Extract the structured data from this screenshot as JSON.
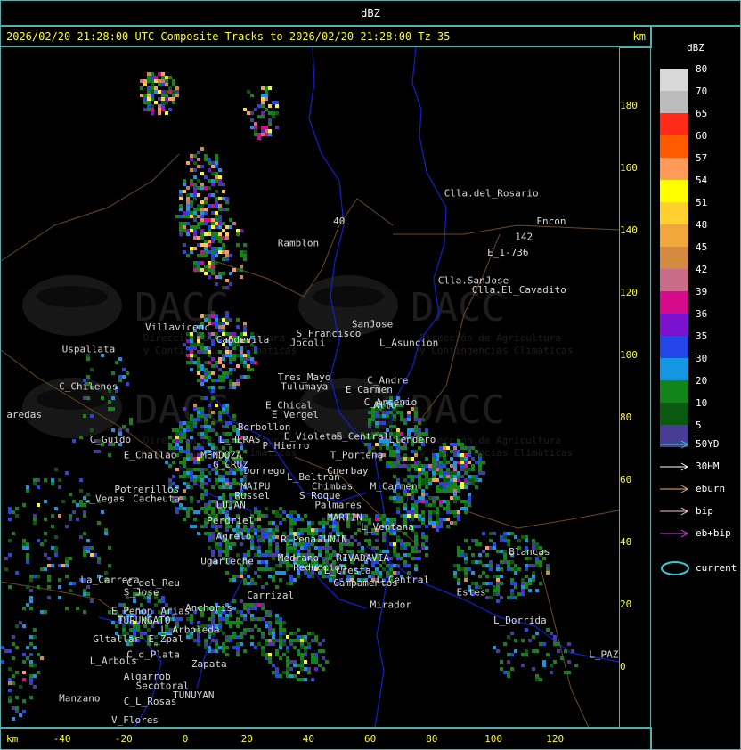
{
  "window_title": "dBZ",
  "header": {
    "title": "2026/02/20 21:28:00 UTC Composite Tracks to 2026/02/20 21:28:00 Tz 35",
    "km_label": "km"
  },
  "axes": {
    "y_label": "km",
    "y_ticks": [
      "180",
      "160",
      "140",
      "120",
      "100",
      "80",
      "60",
      "40",
      "20",
      "0"
    ],
    "x_label": "km",
    "x_ticks": [
      "-40",
      "-20",
      "0",
      "20",
      "40",
      "60",
      "80",
      "100",
      "120"
    ]
  },
  "watermark": {
    "brand": "DACC",
    "line1": "Dirección de Agricultura",
    "line2": "y Contingencias Climáticas"
  },
  "legend": {
    "title": "dBZ",
    "scale": [
      {
        "label": "80",
        "color": "#d8d8d8"
      },
      {
        "label": "70",
        "color": "#bcbcbc"
      },
      {
        "label": "65",
        "color": "#ff2a1a"
      },
      {
        "label": "60",
        "color": "#ff5a00"
      },
      {
        "label": "57",
        "color": "#ff9a5a"
      },
      {
        "label": "54",
        "color": "#ffff00"
      },
      {
        "label": "51",
        "color": "#ffd02e"
      },
      {
        "label": "48",
        "color": "#f0a83c"
      },
      {
        "label": "45",
        "color": "#d48a40"
      },
      {
        "label": "42",
        "color": "#c86c8a"
      },
      {
        "label": "39",
        "color": "#d80a8c"
      },
      {
        "label": "36",
        "color": "#7a12d0"
      },
      {
        "label": "35",
        "color": "#2446e8"
      },
      {
        "label": "30",
        "color": "#1496e2"
      },
      {
        "label": "20",
        "color": "#12841a"
      },
      {
        "label": "10",
        "color": "#0b5a12"
      },
      {
        "label": "5",
        "color": "#483c94"
      }
    ],
    "tracks": [
      {
        "label": "50YD",
        "color": "#2ec8d0"
      },
      {
        "label": "30HM",
        "color": "#ffffff"
      },
      {
        "label": "eburn",
        "color": "#e8b070"
      },
      {
        "label": "bip",
        "color": "#ffc8d8"
      },
      {
        "label": "eb+bip",
        "color": "#e040e0"
      }
    ],
    "current_label": "current",
    "current_color": "#30d0d8"
  },
  "places": [
    {
      "name": "Clla.del_Rosario",
      "x": 84,
      "y": 151
    },
    {
      "name": "Encon",
      "x": 114,
      "y": 142
    },
    {
      "name": "142",
      "x": 107,
      "y": 137
    },
    {
      "name": "E_1-736",
      "x": 98,
      "y": 132
    },
    {
      "name": "Ramblon",
      "x": 30,
      "y": 135
    },
    {
      "name": "40",
      "x": 48,
      "y": 142
    },
    {
      "name": "Clla.SanJose",
      "x": 82,
      "y": 123
    },
    {
      "name": "Clla.El_Cavadito",
      "x": 93,
      "y": 120
    },
    {
      "name": "Villavicenc",
      "x": -13,
      "y": 108
    },
    {
      "name": "Capdevila",
      "x": 10,
      "y": 104
    },
    {
      "name": "S_Francisco",
      "x": 36,
      "y": 106
    },
    {
      "name": "SanJose",
      "x": 54,
      "y": 109
    },
    {
      "name": "Jocoli",
      "x": 34,
      "y": 103
    },
    {
      "name": "L_Asuncion",
      "x": 63,
      "y": 103
    },
    {
      "name": "Uspallata",
      "x": -40,
      "y": 101
    },
    {
      "name": "Tres_Mayo",
      "x": 30,
      "y": 92
    },
    {
      "name": "C_Andre",
      "x": 59,
      "y": 91
    },
    {
      "name": "E_Carmen",
      "x": 52,
      "y": 88
    },
    {
      "name": "Tulumaya",
      "x": 31,
      "y": 89
    },
    {
      "name": "C_Chilenos",
      "x": -41,
      "y": 89
    },
    {
      "name": "C_Arsenio",
      "x": 58,
      "y": 84
    },
    {
      "name": "E_Chical",
      "x": 26,
      "y": 83
    },
    {
      "name": "E_Vergel",
      "x": 28,
      "y": 80
    },
    {
      "name": "Alto",
      "x": 61,
      "y": 83
    },
    {
      "name": "Borbollon",
      "x": 17,
      "y": 76
    },
    {
      "name": "E_Violetas",
      "x": 32,
      "y": 73
    },
    {
      "name": "E_Central",
      "x": 49,
      "y": 73
    },
    {
      "name": "Llendero",
      "x": 66,
      "y": 72
    },
    {
      "name": "C_Guido",
      "x": -31,
      "y": 72
    },
    {
      "name": "L_HERAS",
      "x": 11,
      "y": 72
    },
    {
      "name": "P_Hierro",
      "x": 25,
      "y": 70
    },
    {
      "name": "E_Challao",
      "x": -20,
      "y": 67
    },
    {
      "name": "MENDOZA",
      "x": 5,
      "y": 67
    },
    {
      "name": "T_Portena",
      "x": 47,
      "y": 67
    },
    {
      "name": "G_CRUZ",
      "x": 9,
      "y": 64
    },
    {
      "name": "Dorrego",
      "x": 19,
      "y": 62
    },
    {
      "name": "Cnerbay",
      "x": 46,
      "y": 62
    },
    {
      "name": "L_Beltran",
      "x": 33,
      "y": 60
    },
    {
      "name": "Chimbas",
      "x": 41,
      "y": 57
    },
    {
      "name": "M_Carmen",
      "x": 60,
      "y": 57
    },
    {
      "name": "Potrerillos",
      "x": -23,
      "y": 56
    },
    {
      "name": "MAIPU",
      "x": 18,
      "y": 57
    },
    {
      "name": "Russel",
      "x": 16,
      "y": 54
    },
    {
      "name": "S_Roque",
      "x": 37,
      "y": 54
    },
    {
      "name": "L_Vegas",
      "x": -33,
      "y": 53
    },
    {
      "name": "Cacheuta",
      "x": -17,
      "y": 53
    },
    {
      "name": "LUJAN",
      "x": 10,
      "y": 51
    },
    {
      "name": "Palmares",
      "x": 42,
      "y": 51
    },
    {
      "name": "MARTIN",
      "x": 46,
      "y": 47
    },
    {
      "name": "Perdriel",
      "x": 7,
      "y": 46
    },
    {
      "name": "L_Ventana",
      "x": 57,
      "y": 44
    },
    {
      "name": "Agrelo",
      "x": 10,
      "y": 41
    },
    {
      "name": "R_Pena",
      "x": 31,
      "y": 40
    },
    {
      "name": "JUNIN",
      "x": 43,
      "y": 40
    },
    {
      "name": "Blancas",
      "x": 105,
      "y": 36
    },
    {
      "name": "Ugarteche",
      "x": 5,
      "y": 33
    },
    {
      "name": "Medrano",
      "x": 30,
      "y": 34
    },
    {
      "name": "RIVADAVIA",
      "x": 49,
      "y": 34
    },
    {
      "name": "Reduccion",
      "x": 35,
      "y": 31
    },
    {
      "name": "L_Cresta",
      "x": 45,
      "y": 30
    },
    {
      "name": "L_Central",
      "x": 62,
      "y": 27
    },
    {
      "name": "La_Carrera",
      "x": -34,
      "y": 27
    },
    {
      "name": "C_del_Reu",
      "x": -19,
      "y": 26
    },
    {
      "name": "Campamentos",
      "x": 48,
      "y": 26
    },
    {
      "name": "Estes",
      "x": 88,
      "y": 23
    },
    {
      "name": "S_Jose",
      "x": -20,
      "y": 23
    },
    {
      "name": "Carrizal",
      "x": 20,
      "y": 22
    },
    {
      "name": "Mirador",
      "x": 60,
      "y": 19
    },
    {
      "name": "Anchoris",
      "x": 0,
      "y": 18
    },
    {
      "name": "E_Penon",
      "x": -24,
      "y": 17
    },
    {
      "name": "Arias",
      "x": -8,
      "y": 17
    },
    {
      "name": "TUPUNGATO",
      "x": -22,
      "y": 14
    },
    {
      "name": "L_Dorrida",
      "x": 100,
      "y": 14
    },
    {
      "name": "L_Arboleda",
      "x": -8,
      "y": 11
    },
    {
      "name": "Gltallar",
      "x": -30,
      "y": 8
    },
    {
      "name": "E_Zpal",
      "x": -12,
      "y": 8
    },
    {
      "name": "L_PAZ",
      "x": 131,
      "y": 3
    },
    {
      "name": "C_d_Plata",
      "x": -19,
      "y": 3
    },
    {
      "name": "L_Arbols",
      "x": -31,
      "y": 1
    },
    {
      "name": "Zapata",
      "x": 2,
      "y": 0
    },
    {
      "name": "Algarrob",
      "x": -20,
      "y": -4
    },
    {
      "name": "Secotoral",
      "x": -16,
      "y": -7
    },
    {
      "name": "TUNUYAN",
      "x": -4,
      "y": -10
    },
    {
      "name": "Manzano",
      "x": -41,
      "y": -11
    },
    {
      "name": "C_L_Rosas",
      "x": -20,
      "y": -12
    },
    {
      "name": "V_Flores",
      "x": -24,
      "y": -18
    },
    {
      "name": "aredas",
      "x": -58,
      "y": 80
    }
  ]
}
